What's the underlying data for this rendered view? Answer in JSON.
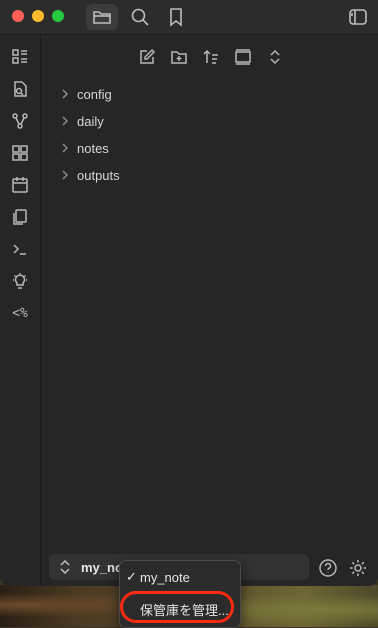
{
  "titlebar": {
    "buttons": [
      {
        "name": "folder-icon",
        "active": true
      },
      {
        "name": "search-icon",
        "active": false
      },
      {
        "name": "bookmark-icon",
        "active": false
      }
    ],
    "right_button": "sidebar-toggle-icon"
  },
  "ribbon": {
    "icons": [
      "dashboard-icon",
      "file-search-icon",
      "graph-icon",
      "grid-icon",
      "calendar-icon",
      "copy-icon",
      "terminal-icon",
      "lightbulb-icon",
      "template-icon"
    ],
    "template_label": "<%"
  },
  "file_nav": {
    "actions": [
      "new-note-icon",
      "new-folder-icon",
      "sort-icon",
      "collapse-icon",
      "expand-icon"
    ],
    "folders": [
      "config",
      "daily",
      "notes",
      "outputs"
    ]
  },
  "vault": {
    "name": "my_no",
    "menu": {
      "items": [
        {
          "check": "✓",
          "label": "my_note"
        },
        {
          "check": "",
          "label": "保管庫を管理..."
        }
      ]
    }
  },
  "colors": {
    "highlight": "#ff2a10",
    "background": "#262626"
  }
}
